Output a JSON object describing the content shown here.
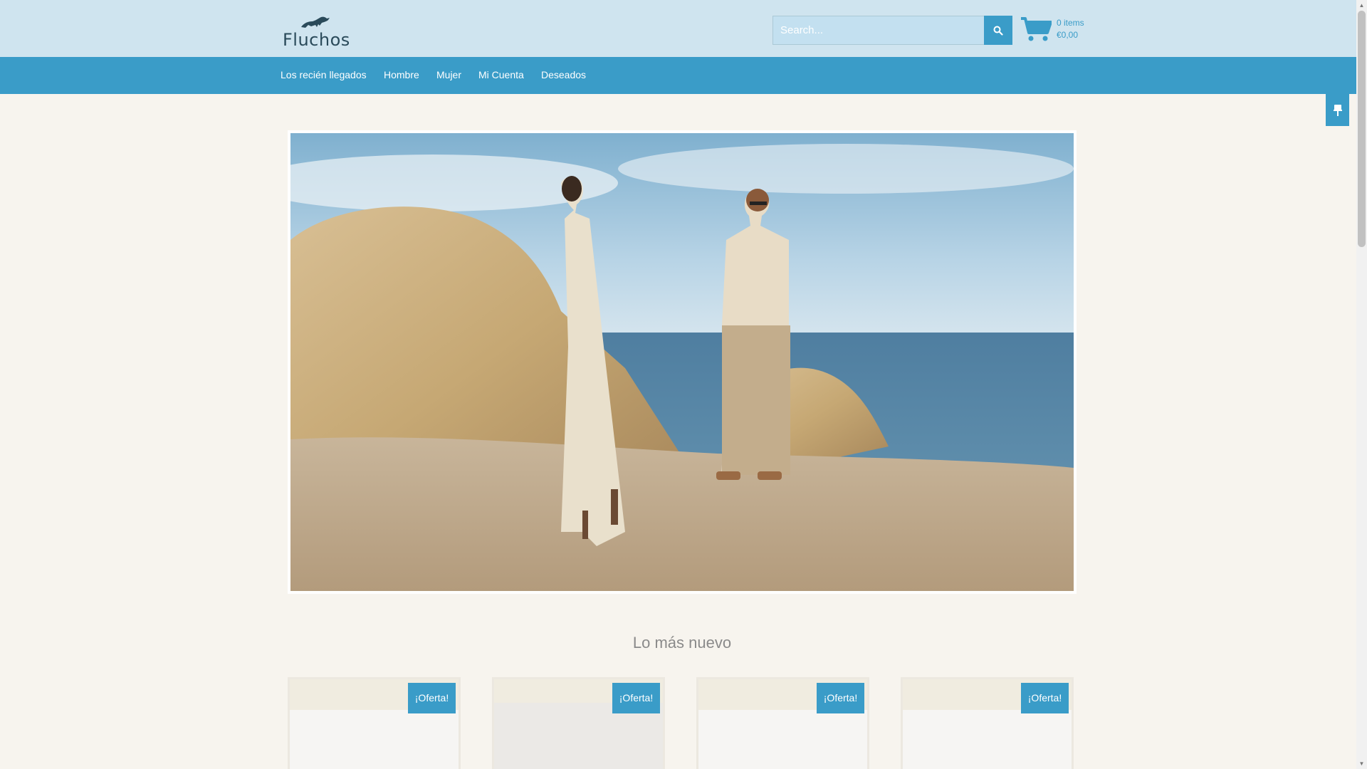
{
  "brand": {
    "name": "Fluchos"
  },
  "search": {
    "placeholder": "Search..."
  },
  "cart": {
    "items": "0 items",
    "total": "€0,00"
  },
  "nav": {
    "items": [
      {
        "label": "Los recién llegados"
      },
      {
        "label": "Hombre"
      },
      {
        "label": "Mujer"
      },
      {
        "label": "Mi Cuenta"
      },
      {
        "label": "Deseados"
      }
    ]
  },
  "section": {
    "title": "Lo más nuevo"
  },
  "products": [
    {
      "badge": "¡Oferta!"
    },
    {
      "badge": "¡Oferta!"
    },
    {
      "badge": "¡Oferta!"
    },
    {
      "badge": "¡Oferta!"
    }
  ],
  "colors": {
    "accent": "#3a9cc8",
    "topbar": "#cfe4ef",
    "background": "#f7f4ee"
  },
  "icons": {
    "search": "search-icon",
    "cart": "cart-icon",
    "pin": "pin-icon"
  }
}
